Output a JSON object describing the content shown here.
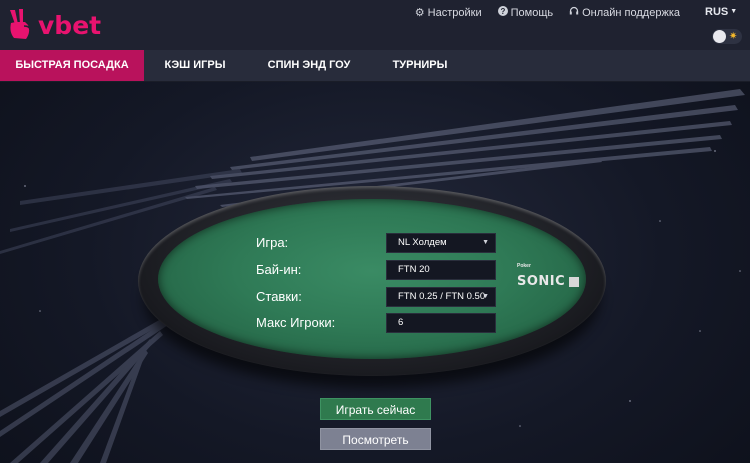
{
  "header": {
    "logo_text": "vbet",
    "links": [
      {
        "label": "Настройки",
        "icon": "gear-icon"
      },
      {
        "label": "Помощь",
        "icon": "help-icon"
      },
      {
        "label": "Онлайн поддержка",
        "icon": "headset-icon"
      }
    ],
    "language": "RUS",
    "accent_color": "#e8136f"
  },
  "nav": {
    "tabs": [
      {
        "label": "БЫСТРАЯ ПОСАДКА",
        "active": true
      },
      {
        "label": "КЭШ ИГРЫ",
        "active": false
      },
      {
        "label": "СПИН ЭНД  ГОУ",
        "active": false
      },
      {
        "label": "ТУРНИРЫ",
        "active": false
      }
    ],
    "active_color": "#b9125c"
  },
  "form": {
    "game_label": "Игра:",
    "game_value": "NL Холдем",
    "buyin_label": "Бай-ин:",
    "buyin_value": "FTN 20",
    "stakes_label": "Ставки:",
    "stakes_value": "FTN 0.25 / FTN 0.50",
    "max_players_label": "Макс Игроки:",
    "max_players_value": "6"
  },
  "sonic_badge": {
    "small_text": "Poker",
    "brand_text": "SONIC"
  },
  "actions": {
    "play_label": "Играть сейчас",
    "view_label": "Посмотреть"
  }
}
